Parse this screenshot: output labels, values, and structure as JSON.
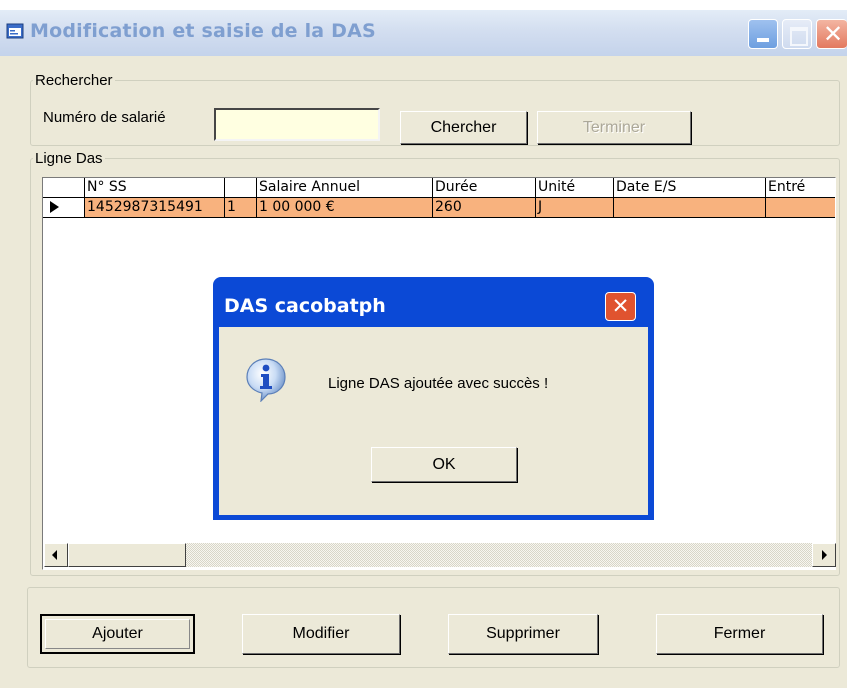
{
  "window": {
    "title": "Modification et saisie de la DAS",
    "minimize_icon": "minimize-icon",
    "maximize_icon": "maximize-icon",
    "close_icon": "close-icon",
    "close_glyph": "✕"
  },
  "search_group": {
    "legend": "Rechercher",
    "employee_number_label": "Numéro de salarié",
    "employee_number_value": "",
    "employee_number_placeholder": "",
    "search_button": "Chercher",
    "finish_button": "Terminer"
  },
  "grid_group": {
    "legend": "Ligne Das",
    "columns": [
      "",
      "N° SS",
      "",
      "Salaire Annuel",
      "Durée",
      "Unité",
      "Date E/S",
      "Entré"
    ],
    "rows": [
      {
        "cells": [
          "",
          "1452987315491",
          "1",
          "1 00 000 €",
          "260",
          "J",
          "",
          ""
        ],
        "selected": true
      }
    ]
  },
  "actions": {
    "add": "Ajouter",
    "modify": "Modifier",
    "delete": "Supprimer",
    "close": "Fermer"
  },
  "dialog": {
    "title": "DAS cacobatph",
    "message": "Ligne DAS ajoutée avec succès !",
    "ok": "OK",
    "icon": "info-icon",
    "close_glyph": "✕"
  },
  "colors": {
    "selected_row": "#f8b27e",
    "dialog_frame": "#0b49d6",
    "window_face": "#ece9d8",
    "input_background": "#ffffe1"
  }
}
